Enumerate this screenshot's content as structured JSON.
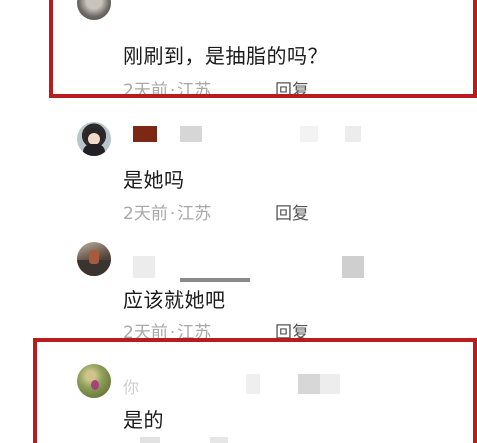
{
  "comments": [
    {
      "text": "刚刷到，是抽脂的吗？",
      "time": "2天前",
      "dot": "·",
      "location": "江苏",
      "reply": "回复"
    },
    {
      "text": "是她吗",
      "time": "2天前",
      "dot": "·",
      "location": "江苏",
      "reply": "回复"
    },
    {
      "text": "应该就她吧",
      "time": "2天前",
      "dot": "·",
      "location": "江苏",
      "reply": "回复"
    },
    {
      "username_fragment": "你",
      "text": "是的"
    }
  ],
  "colors": {
    "highlight": "#b81c1c",
    "meta_text": "#a8a8a8",
    "reply_text": "#555555",
    "body_text": "#1a1a1a"
  },
  "icons": [
    "avatar-image"
  ]
}
